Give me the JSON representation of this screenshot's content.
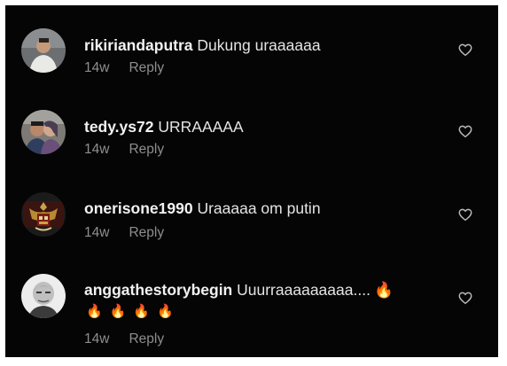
{
  "comments": [
    {
      "username": "rikiriandaputra",
      "text": "Dukung uraaaaaa",
      "time": "14w",
      "reply": "Reply",
      "avatar": "person-avatar",
      "flames_inline": 0,
      "flames_line": 0
    },
    {
      "username": "tedy.ys72",
      "text": "URRAAAAA",
      "time": "14w",
      "reply": "Reply",
      "avatar": "couple-avatar",
      "flames_inline": 0,
      "flames_line": 0
    },
    {
      "username": "onerisone1990",
      "text": "Uraaaaa om putin",
      "time": "14w",
      "reply": "Reply",
      "avatar": "emblem-avatar",
      "flames_inline": 0,
      "flames_line": 0
    },
    {
      "username": "anggathestorybegin",
      "text": "Uuurraaaaaaaaa....",
      "time": "14w",
      "reply": "Reply",
      "avatar": "bald-man-avatar",
      "flames_inline": 1,
      "flames_line": 4
    }
  ],
  "icons": {
    "like": "heart-outline-icon",
    "emoji": "fire-emoji"
  },
  "colors": {
    "background": "#050505",
    "text": "#e9e9e9",
    "meta": "#8e8e8e",
    "heart": "#b9b9b9",
    "flame": "#ff8a1e"
  }
}
